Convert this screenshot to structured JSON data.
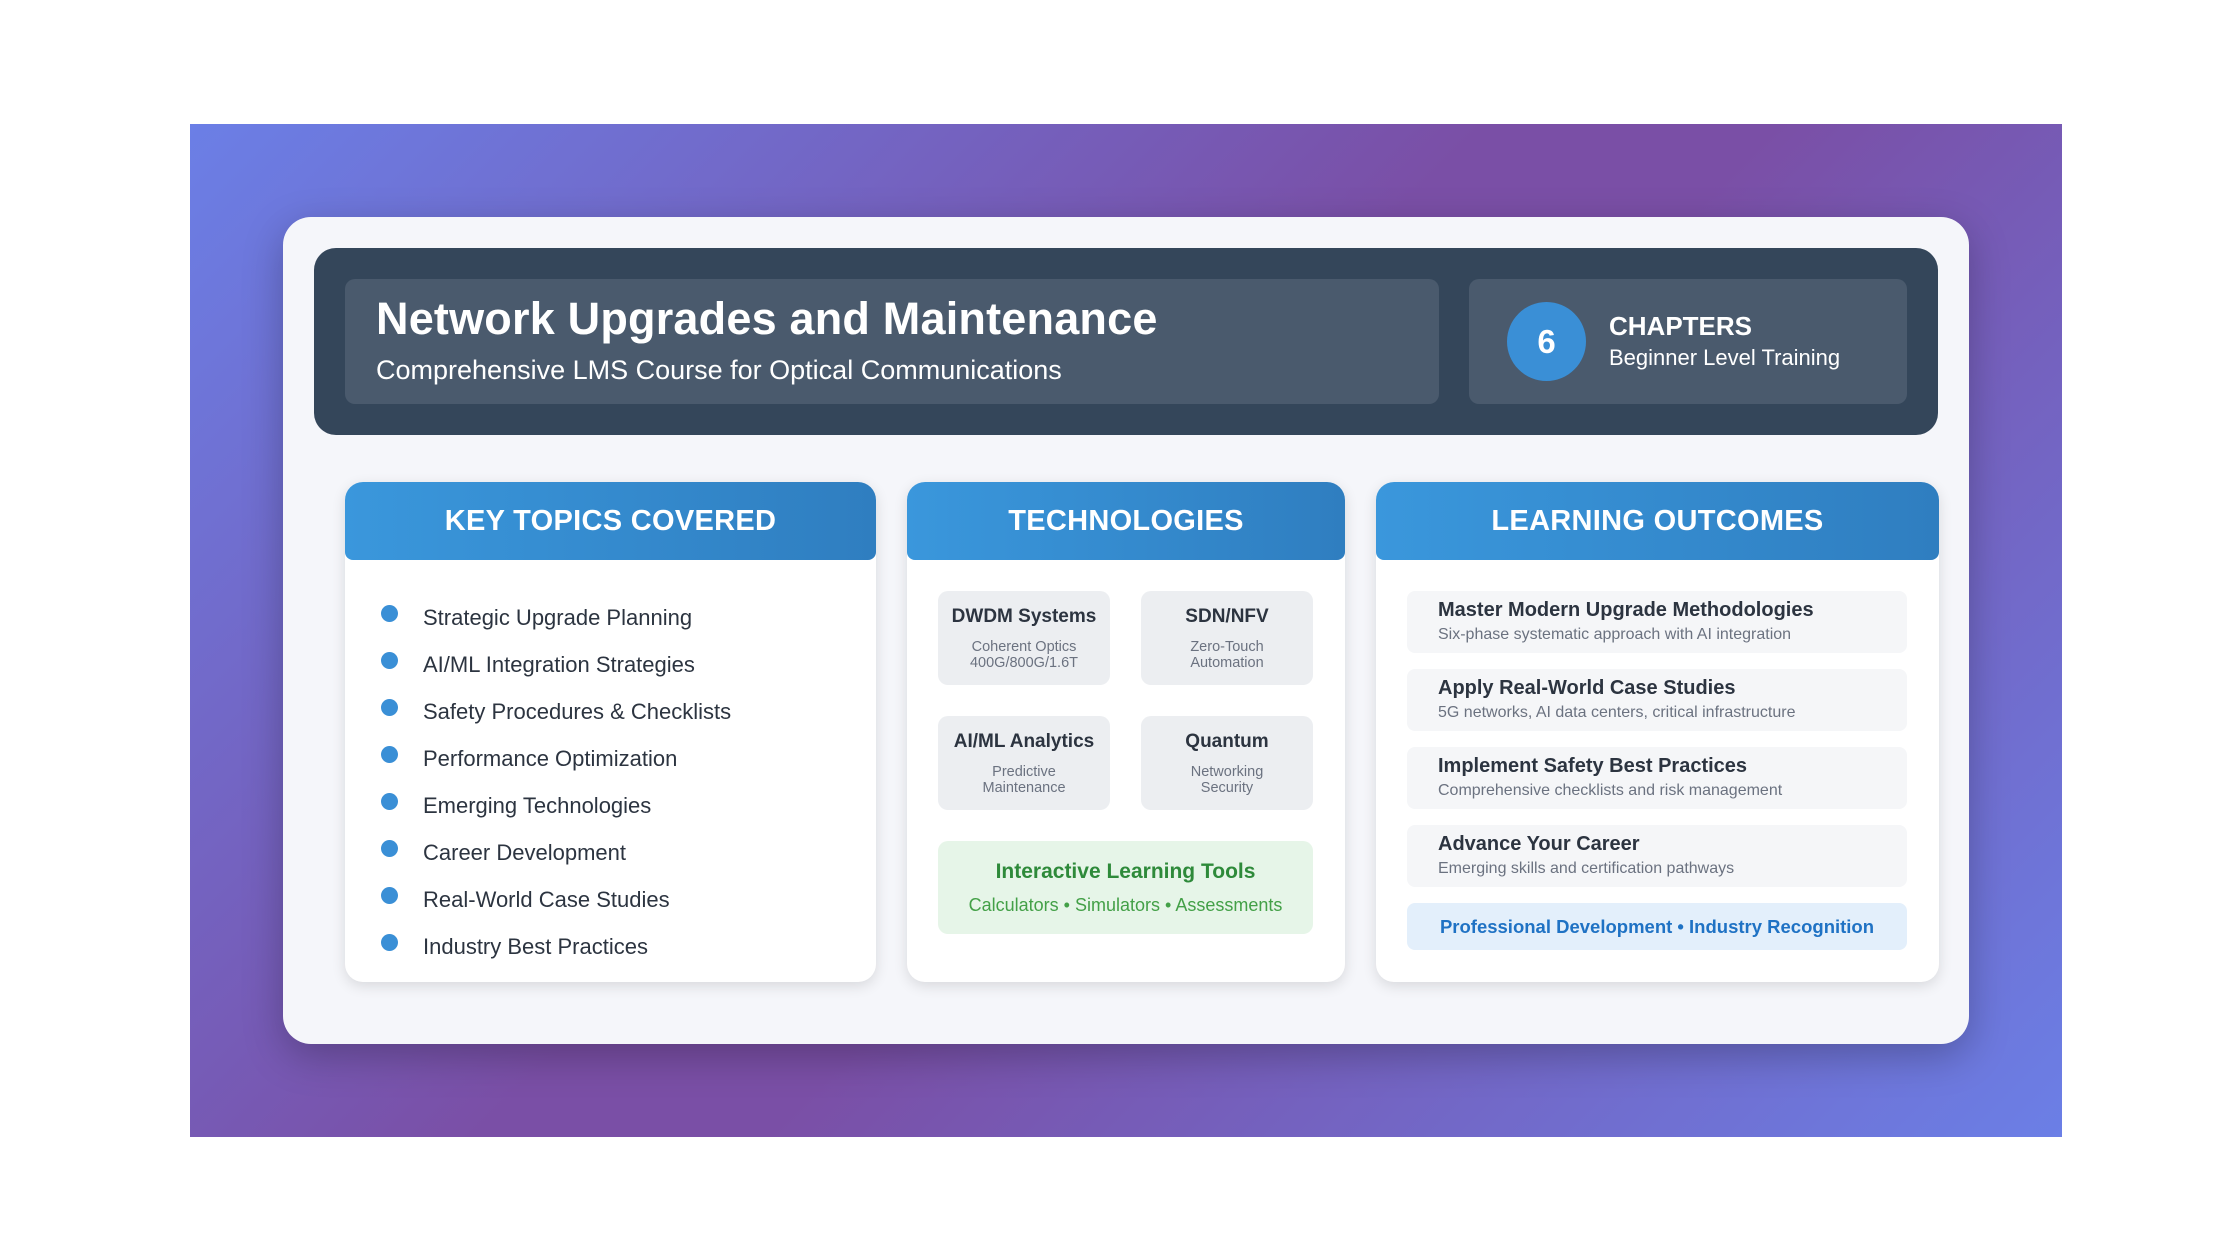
{
  "header": {
    "title": "Network Upgrades and Maintenance",
    "subtitle": "Comprehensive LMS Course for Optical Communications",
    "chapter_count": "6",
    "chapter_label": "CHAPTERS",
    "level": "Beginner Level Training"
  },
  "topics": {
    "heading": "KEY TOPICS COVERED",
    "items": [
      "Strategic Upgrade Planning",
      "AI/ML Integration Strategies",
      "Safety Procedures & Checklists",
      "Performance Optimization",
      "Emerging Technologies",
      "Career Development",
      "Real-World Case Studies",
      "Industry Best Practices"
    ]
  },
  "technologies": {
    "heading": "TECHNOLOGIES",
    "items": [
      {
        "name": "DWDM Systems",
        "line1": "Coherent Optics",
        "line2": "400G/800G/1.6T"
      },
      {
        "name": "SDN/NFV",
        "line1": "Zero-Touch",
        "line2": "Automation"
      },
      {
        "name": "AI/ML Analytics",
        "line1": "Predictive",
        "line2": "Maintenance"
      },
      {
        "name": "Quantum",
        "line1": "Networking",
        "line2": "Security"
      }
    ],
    "tools_title": "Interactive Learning Tools",
    "tools_sub": "Calculators • Simulators • Assessments"
  },
  "outcomes": {
    "heading": "LEARNING OUTCOMES",
    "items": [
      {
        "title": "Master Modern Upgrade Methodologies",
        "desc": "Six-phase systematic approach with AI integration"
      },
      {
        "title": "Apply Real-World Case Studies",
        "desc": "5G networks, AI data centers, critical infrastructure"
      },
      {
        "title": "Implement Safety Best Practices",
        "desc": "Comprehensive checklists and risk management"
      },
      {
        "title": "Advance Your Career",
        "desc": "Emerging skills and certification pathways"
      }
    ],
    "footer": "Professional Development • Industry Recognition"
  },
  "colors": {
    "accent_blue": "#3a8fd6",
    "header_dark": "#34465a",
    "tools_green": "#2e8a3a"
  }
}
